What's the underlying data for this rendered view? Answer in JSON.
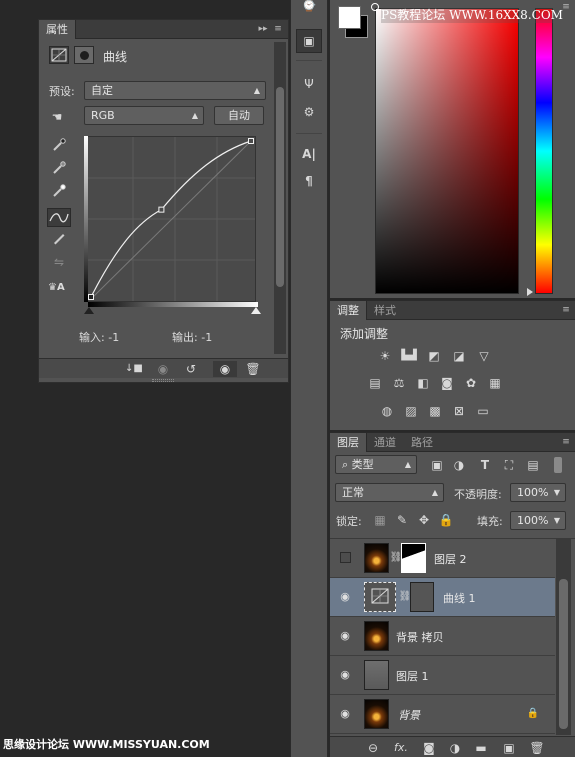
{
  "watermarks": {
    "top_url": "PS教程论坛 WWW.16XX8.COM",
    "bottom_logo": "思缘设计论坛 WWW.MISSYUAN.COM"
  },
  "properties": {
    "tab_label": "属性",
    "title": "曲线",
    "preset_label": "预设:",
    "preset_value": "自定",
    "channel_value": "RGB",
    "auto_button": "自动",
    "input_label": "输入:",
    "input_value": "-1",
    "output_label": "输出:",
    "output_value": "-1",
    "curve_points_fraction": [
      [
        0.0,
        0.0
      ],
      [
        0.44,
        0.56
      ],
      [
        1.0,
        1.0
      ]
    ]
  },
  "adjustments": {
    "tabs": [
      "调整",
      "样式"
    ],
    "title": "添加调整"
  },
  "layers": {
    "tabs": [
      "图层",
      "通道",
      "路径"
    ],
    "filter_kind": "类型",
    "blend_mode": "正常",
    "opacity_label": "不透明度:",
    "opacity_value": "100%",
    "lock_label": "锁定:",
    "fill_label": "填充:",
    "fill_value": "100%",
    "rows": [
      {
        "name": "图层 2",
        "visible": false,
        "selected": false,
        "type": "masked"
      },
      {
        "name": "曲线 1",
        "visible": true,
        "selected": true,
        "type": "curves"
      },
      {
        "name": "背景 拷贝",
        "visible": true,
        "selected": false,
        "type": "image"
      },
      {
        "name": "图层 1",
        "visible": true,
        "selected": false,
        "type": "gray"
      },
      {
        "name": "背景",
        "visible": true,
        "selected": false,
        "type": "background",
        "locked": true
      }
    ]
  },
  "colors": {
    "foreground": "#ffffff",
    "background": "#000000",
    "hue": "#ff0000",
    "selection_accent": "#6c7a8c"
  }
}
